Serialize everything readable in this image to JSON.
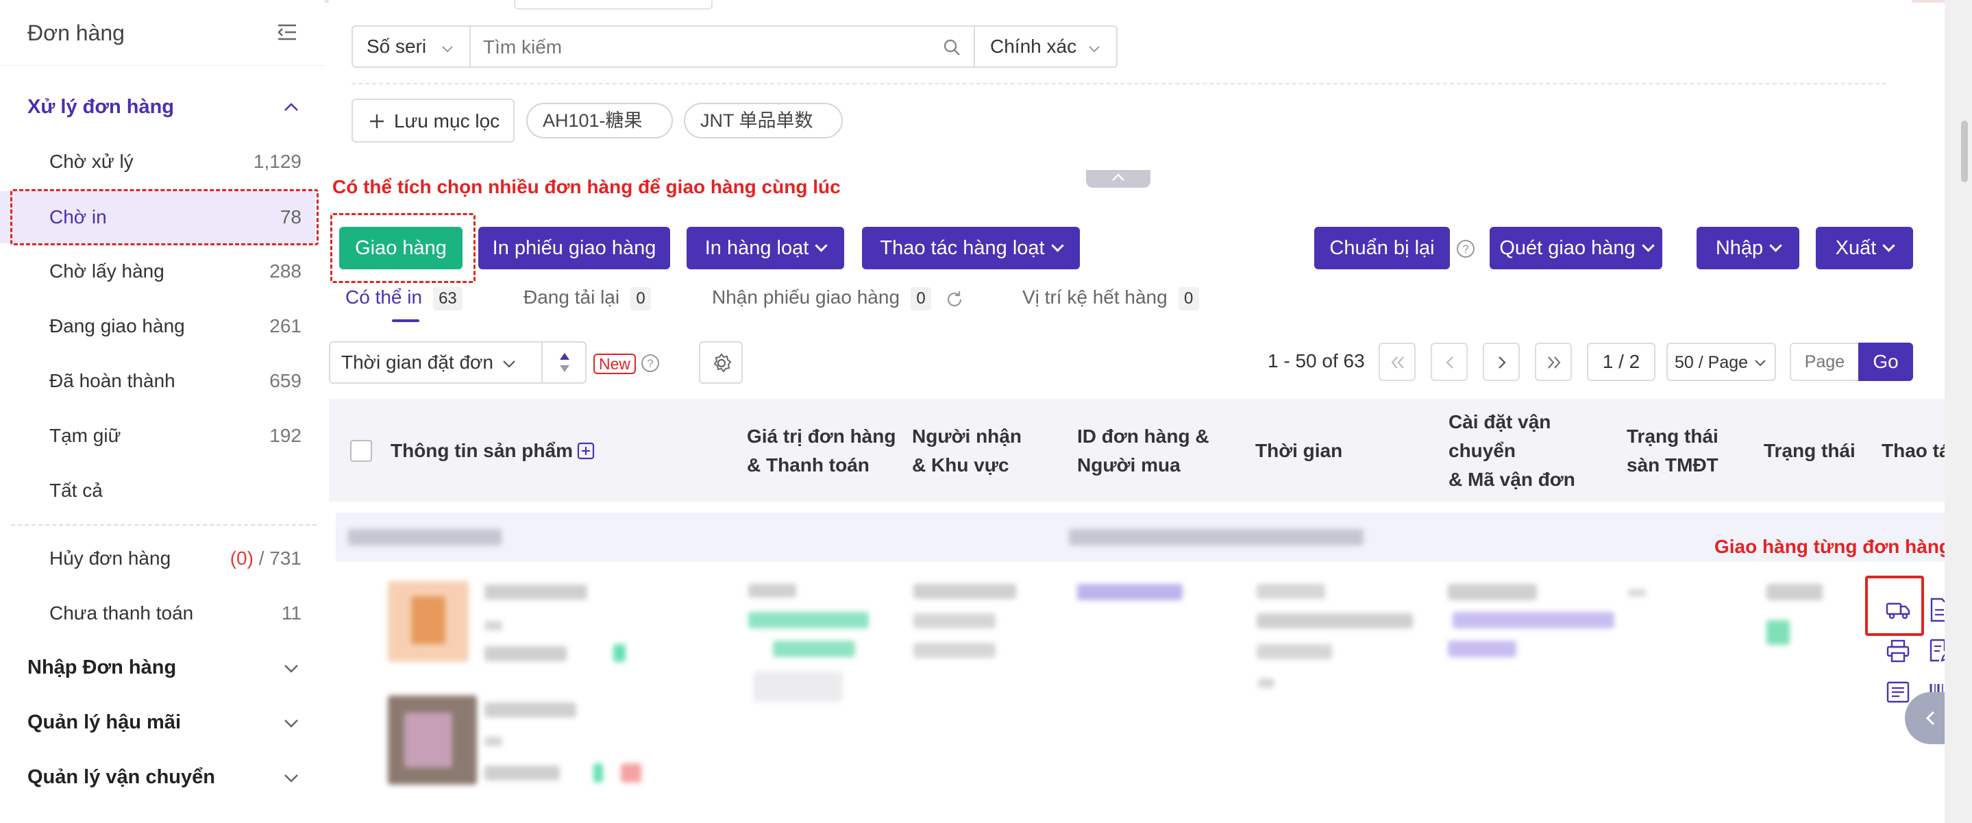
{
  "sidebar": {
    "title": "Đơn hàng",
    "sections": {
      "processing": "Xử lý đơn hàng",
      "import": "Nhập Đơn hàng",
      "after_sales": "Quản lý hậu mãi",
      "shipping": "Quản lý vận chuyển"
    },
    "items": [
      {
        "label": "Chờ xử lý",
        "count": "1,129"
      },
      {
        "label": "Chờ in",
        "count": "78"
      },
      {
        "label": "Chờ lấy hàng",
        "count": "288"
      },
      {
        "label": "Đang giao hàng",
        "count": "261"
      },
      {
        "label": "Đã hoàn thành",
        "count": "659"
      },
      {
        "label": "Tạm giữ",
        "count": "192"
      },
      {
        "label": "Tất cả",
        "count": ""
      }
    ],
    "cancel": {
      "label": "Hủy đơn hàng",
      "count_open": "(0)",
      "count_total": "/ 731"
    },
    "unpaid": {
      "label": "Chưa thanh toán",
      "count": "11"
    }
  },
  "filter": {
    "field_select": "Số seri",
    "search_placeholder": "Tìm kiếm",
    "match_select": "Chính xác",
    "save_filter": "Lưu mục lọc",
    "saved_filters": [
      "AH101-糖果",
      "JNT 单品单数"
    ]
  },
  "hints": {
    "bulk": "Có thể tích chọn nhiều đơn hàng để giao hàng cùng lúc",
    "single": "Giao hàng từng đơn hàng"
  },
  "actions": {
    "ship": "Giao hàng",
    "print_delivery": "In phiếu giao hàng",
    "bulk_print": "In hàng loạt",
    "bulk_ops": "Thao tác hàng loạt",
    "prepare_again": "Chuẩn bị lại",
    "scan_ship": "Quét giao hàng",
    "import": "Nhập",
    "export": "Xuất"
  },
  "tabs": [
    {
      "label": "Có thể in",
      "count": "63"
    },
    {
      "label": "Đang tải lại",
      "count": "0"
    },
    {
      "label": "Nhận phiếu giao hàng",
      "count": "0"
    },
    {
      "label": "Vị trí kệ hết hàng",
      "count": "0"
    }
  ],
  "sort": {
    "label": "Thời gian đặt đơn",
    "new_badge": "New"
  },
  "pagination": {
    "range": "1 - 50 of 63",
    "page": "1 / 2",
    "per_page": "50 / Page",
    "page_placeholder": "Page",
    "go": "Go"
  },
  "table": {
    "headers": {
      "product": "Thông tin sản phẩm",
      "value_l1": "Giá trị đơn hàng",
      "value_l2": "& Thanh toán",
      "recipient_l1": "Người nhận",
      "recipient_l2": "& Khu vực",
      "order_id_l1": "ID đơn hàng &",
      "order_id_l2": "Người mua",
      "time": "Thời gian",
      "shipping_l1": "Cài đặt vận",
      "shipping_l2": "chuyển",
      "shipping_l3": "& Mã vận đơn",
      "platform_status_l1": "Trạng thái",
      "platform_status_l2": "sàn TMĐT",
      "status": "Trạng thái",
      "ops": "Thao tác"
    }
  },
  "colors": {
    "primary": "#4a32b4",
    "ship_green": "#1bb37f",
    "annotation_red": "#e52222"
  }
}
